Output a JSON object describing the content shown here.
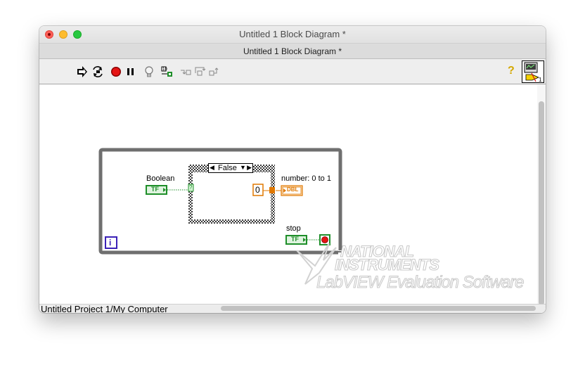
{
  "window": {
    "title": "Untitled 1 Block Diagram *"
  },
  "tab": {
    "title": "Untitled 1 Block Diagram *"
  },
  "toolbar": {
    "items": [
      "run-continuously-icon",
      "abort-execution-icon",
      "pause-icon",
      "highlight-execution-icon",
      "retain-wire-values-icon",
      "step-into-icon",
      "step-over-icon",
      "step-out-icon"
    ],
    "help": "?",
    "connector_pane_number": "1"
  },
  "diagram": {
    "case_selector": "False",
    "boolean_label": "Boolean",
    "boolean_terminal": "TF",
    "numeric_constant": "0",
    "number_label": "number: 0 to 1",
    "dbl_terminal": "DBL",
    "stop_label": "stop",
    "stop_terminal": "TF",
    "iteration_terminal": "i",
    "selector_terminal": "?"
  },
  "watermark": {
    "line1": "NATIONAL",
    "line2": "INSTRUMENTS",
    "line3": "LabVIEW Evaluation Software",
    "tm": "™"
  },
  "status": {
    "project": "Untitled Project 1/My Computer"
  },
  "colors": {
    "boolean_green": "#1f8f2a",
    "numeric_orange": "#e07800",
    "loop_gray": "#6f6f6f",
    "iteration_blue": "#3b21b7"
  }
}
